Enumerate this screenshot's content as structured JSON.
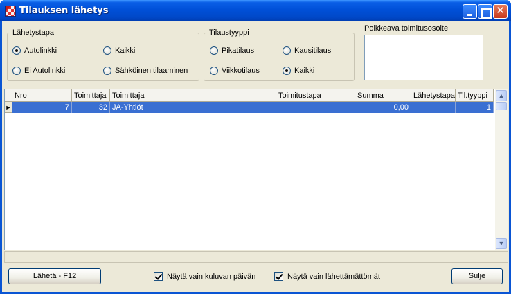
{
  "window": {
    "title": "Tilauksen lähetys",
    "icon": "app-checker-icon",
    "controls": {
      "minimize": "minimize-icon",
      "maximize": "maximize-icon",
      "close": "close-icon",
      "close_glyph": "✕"
    }
  },
  "lahetystapa": {
    "legend": "Lähetystapa",
    "options": [
      {
        "label": "Autolinkki",
        "selected": true
      },
      {
        "label": "Kaikki",
        "selected": false
      },
      {
        "label": "Ei Autolinkki",
        "selected": false
      },
      {
        "label": "Sähköinen tilaaminen",
        "selected": false
      }
    ]
  },
  "tilaustyyppi": {
    "legend": "Tilaustyyppi",
    "options": [
      {
        "label": "Pikatilaus",
        "selected": false
      },
      {
        "label": "Kausitilaus",
        "selected": false
      },
      {
        "label": "Viikkotilaus",
        "selected": false
      },
      {
        "label": "Kaikki",
        "selected": true
      }
    ]
  },
  "address": {
    "label": "Poikkeava toimitusosoite",
    "value": ""
  },
  "grid": {
    "columns": [
      "Nro",
      "Toimittaja",
      "Toimittaja",
      "Toimitustapa",
      "Summa",
      "Lähetystapa",
      "Til.tyyppi"
    ],
    "rows": [
      {
        "nro": "7",
        "toimittaja_id": "32",
        "toimittaja": "JA-Yhtiöt",
        "toimitustapa": "",
        "summa": "0,00",
        "lahetystapa": "",
        "tiltyyppi": "1"
      }
    ],
    "row_indicator": "►",
    "scroll_up": "▲",
    "scroll_down": "▼",
    "selection_color": "#3a6fd2"
  },
  "footer": {
    "send_button": "Lähetä - F12",
    "checkbox_today": {
      "label": "Näytä vain kuluvan päivän",
      "checked": true
    },
    "checkbox_unsent": {
      "label": "Näytä vain lähettämättömät",
      "checked": true
    },
    "close_button": "Sulje"
  }
}
